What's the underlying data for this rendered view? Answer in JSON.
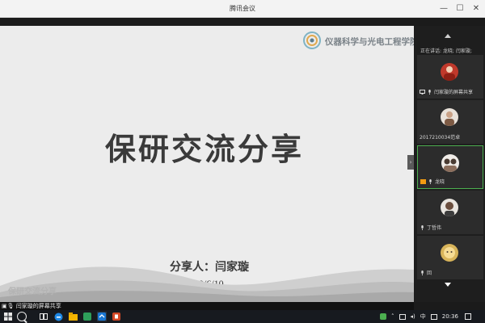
{
  "window": {
    "title": "腾讯会议",
    "minimize_glyph": "—",
    "maximize_glyph": "☐",
    "close_glyph": "✕"
  },
  "slide": {
    "logo_text": "仪器科学与光电工程学院",
    "title": "保研交流分享",
    "presenter": "分享人：闫家璇",
    "date": "2020/6/10",
    "footer": "保研交流分享"
  },
  "panel": {
    "speaking_label": "正在讲话: 龙晓; 闫家璇;",
    "participants": [
      {
        "name": "闫家璇的屏幕共享",
        "avatar_color": "#c0392b",
        "icons": [
          "screen-icon",
          "mic-icon"
        ]
      },
      {
        "name": "2017210034范卓",
        "avatar_color": "#7d5a44",
        "icons": []
      },
      {
        "name": "龙晓",
        "avatar_color": "#4a3b32",
        "icons": [
          "orange-badge-icon",
          "mic-icon"
        ],
        "active": true
      },
      {
        "name": "丁哲伟",
        "avatar_color": "#6b4e3d",
        "icons": [
          "mic-icon"
        ]
      },
      {
        "name": "回",
        "avatar_color": "#d8b45a",
        "icons": [
          "mic-icon"
        ]
      }
    ]
  },
  "status": {
    "text": "闫家璇的屏幕共享"
  },
  "taskbar": {
    "apps": [
      "windows-start-icon",
      "search-icon",
      "task-view-icon",
      "edge-browser-icon",
      "file-explorer-icon",
      "app-icon-green",
      "tencent-meeting-icon",
      "powerpoint-icon"
    ],
    "tray": {
      "ime": "中",
      "time": "20:36"
    }
  },
  "colors": {
    "slide_bg": "#ececec",
    "panel_bg": "#1e1e1e",
    "active_border": "#4caf50",
    "taskbar_bg": "#171a1f"
  }
}
